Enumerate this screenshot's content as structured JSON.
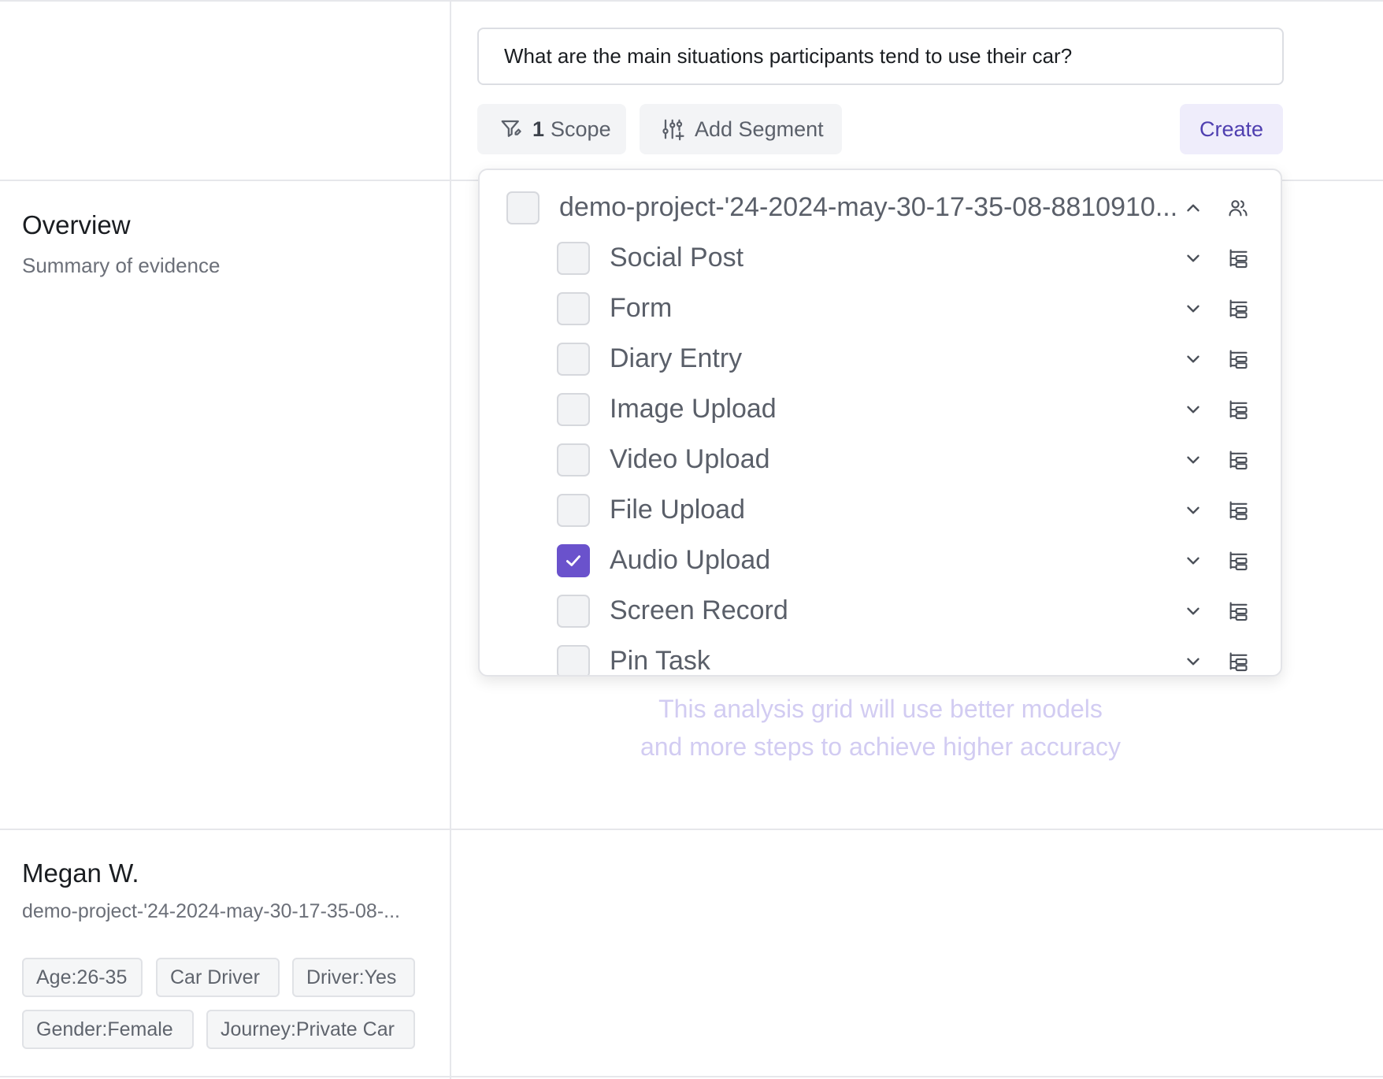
{
  "query": {
    "text": "What are the main situations participants tend to use their car?"
  },
  "toolbar": {
    "scope_count": "1",
    "scope_label": "Scope",
    "add_segment_label": "Add Segment",
    "create_label": "Create"
  },
  "dropdown": {
    "project": {
      "label": "demo-project-'24-2024-may-30-17-35-08-8810910...",
      "checked": false
    },
    "items": [
      {
        "label": "Social Post",
        "checked": false
      },
      {
        "label": "Form",
        "checked": false
      },
      {
        "label": "Diary Entry",
        "checked": false
      },
      {
        "label": "Image Upload",
        "checked": false
      },
      {
        "label": "Video Upload",
        "checked": false
      },
      {
        "label": "File Upload",
        "checked": false
      },
      {
        "label": "Audio Upload",
        "checked": true
      },
      {
        "label": "Screen Record",
        "checked": false
      },
      {
        "label": "Pin Task",
        "checked": false
      }
    ]
  },
  "overview": {
    "title": "Overview",
    "subtitle": "Summary of evidence"
  },
  "hint": {
    "line1": "This analysis grid will use better models",
    "line2": "and more steps to achieve higher accuracy"
  },
  "participant": {
    "name": "Megan W.",
    "project": "demo-project-'24-2024-may-30-17-35-08-...",
    "tags": [
      "Age:26-35",
      "Car Driver",
      "Driver:Yes",
      "Gender:Female",
      "Journey:Private Car"
    ]
  },
  "colors": {
    "accent": "#6a52cc",
    "create_text": "#4f3fb0",
    "create_bg": "#efedfb",
    "hint_text": "#d2ccf2"
  }
}
